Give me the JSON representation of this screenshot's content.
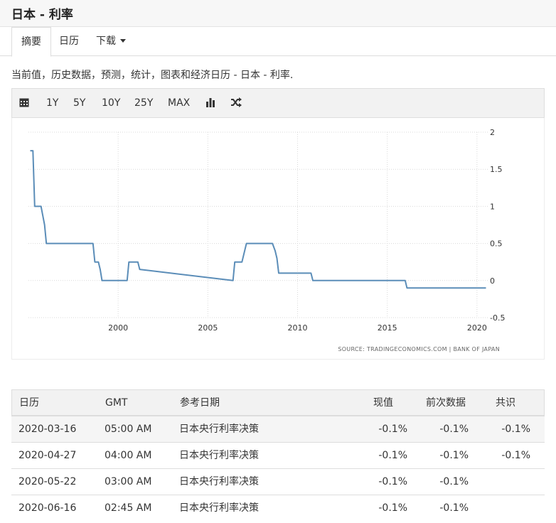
{
  "page": {
    "title": "日本 - 利率"
  },
  "tabs": [
    {
      "label": "摘要"
    },
    {
      "label": "日历"
    },
    {
      "label": "下载"
    }
  ],
  "description": "当前值，历史数据，预测，统计，图表和经济日历 - 日本 - 利率.",
  "toolbar": {
    "calendar_icon": "calendar-icon",
    "ranges": [
      "1Y",
      "5Y",
      "10Y",
      "25Y",
      "MAX"
    ],
    "bar_icon": "bar-chart-icon",
    "shuffle_icon": "shuffle-icon"
  },
  "chart_data": {
    "type": "line",
    "title": "",
    "xlabel": "",
    "ylabel": "",
    "xlim": [
      1995,
      2020.6
    ],
    "ylim": [
      -0.5,
      2
    ],
    "x_ticks": [
      "2000",
      "2005",
      "2010",
      "2015",
      "2020"
    ],
    "y_ticks": [
      "2",
      "1.5",
      "1",
      "0.5",
      "0",
      "-0.5"
    ],
    "grid": true,
    "source": "SOURCE: TRADINGECONOMICS.COM | BANK OF JAPAN",
    "line_color": "#5b8db8",
    "series": [
      {
        "name": "",
        "x": [
          1995.1,
          1995.25,
          1995.35,
          1995.7,
          1995.9,
          1996.0,
          1998.6,
          1998.7,
          1998.9,
          1999.0,
          1999.1,
          2000.5,
          2000.6,
          2000.9,
          2001.1,
          2001.2,
          2006.4,
          2006.5,
          2006.6,
          2006.9,
          2007.05,
          2007.15,
          2008.6,
          2008.75,
          2008.85,
          2008.95,
          2010.75,
          2010.85,
          2016.0,
          2016.1,
          2020.5
        ],
        "y": [
          1.75,
          1.75,
          1.0,
          1.0,
          0.75,
          0.5,
          0.5,
          0.25,
          0.25,
          0.15,
          0.0,
          0.0,
          0.25,
          0.25,
          0.25,
          0.15,
          0.0,
          0.25,
          0.25,
          0.25,
          0.4,
          0.5,
          0.5,
          0.4,
          0.3,
          0.1,
          0.1,
          0.0,
          0.0,
          -0.1,
          -0.1
        ]
      }
    ]
  },
  "calendar_table": {
    "headers": [
      "日历",
      "GMT",
      "参考日期",
      "现值",
      "前次数据",
      "共识"
    ],
    "rows": [
      [
        "2020-03-16",
        "05:00 AM",
        "日本央行利率决策",
        "-0.1%",
        "-0.1%",
        "-0.1%"
      ],
      [
        "2020-04-27",
        "04:00 AM",
        "日本央行利率决策",
        "-0.1%",
        "-0.1%",
        "-0.1%"
      ],
      [
        "2020-05-22",
        "03:00 AM",
        "日本央行利率决策",
        "-0.1%",
        "-0.1%",
        ""
      ],
      [
        "2020-06-16",
        "02:45 AM",
        "日本央行利率决策",
        "-0.1%",
        "-0.1%",
        ""
      ]
    ]
  }
}
